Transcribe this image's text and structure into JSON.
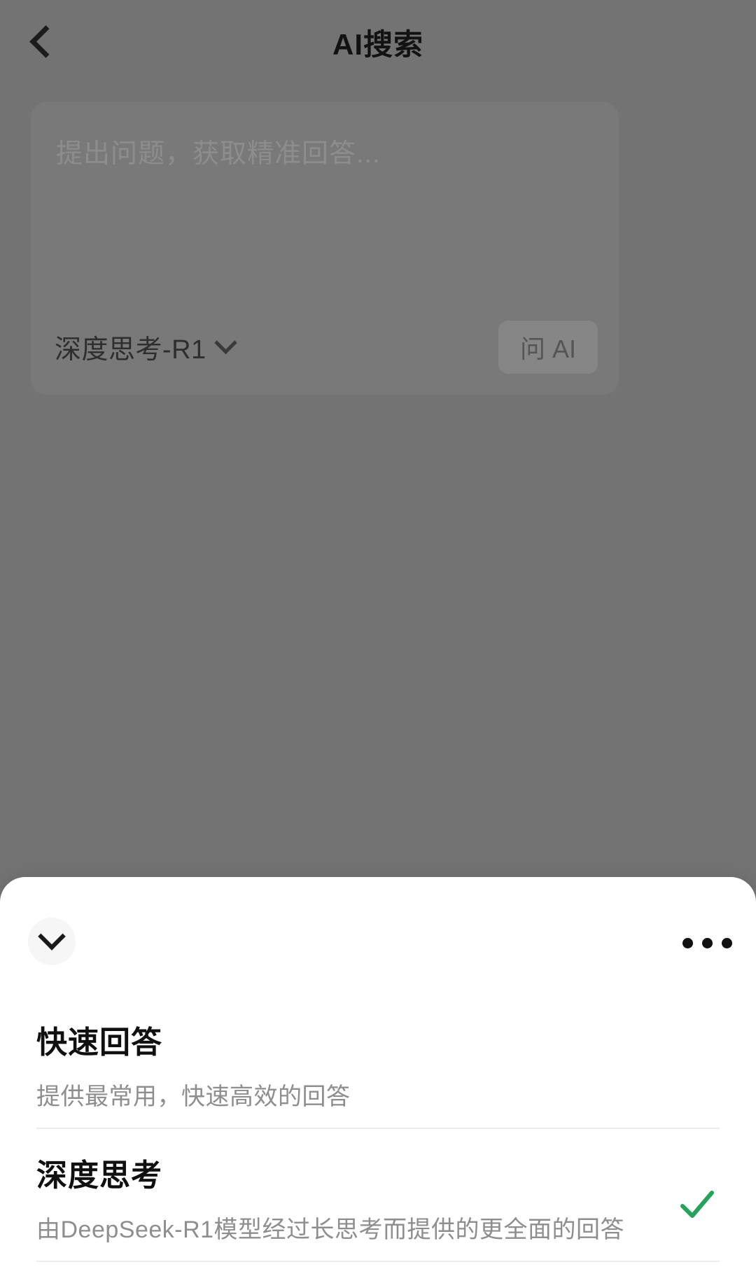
{
  "nav": {
    "back_icon": "chevron-left-icon",
    "title": "AI搜索"
  },
  "composer": {
    "placeholder": "提出问题，获取精准回答...",
    "model_label": "深度思考-R1",
    "model_chevron_icon": "chevron-down-icon",
    "ask_button_label": "问 AI"
  },
  "sheet": {
    "collapse_icon": "chevron-down-icon",
    "more_icon": "more-horizontal-icon",
    "options": [
      {
        "title": "快速回答",
        "desc": "提供最常用，快速高效的回答",
        "selected": false
      },
      {
        "title": "深度思考",
        "desc": "由DeepSeek-R1模型经过长思考而提供的更全面的回答",
        "selected": true,
        "check_icon": "check-icon"
      }
    ]
  },
  "colors": {
    "scrim": "#737373",
    "sheet_bg": "#ffffff",
    "accent_check": "#26a35a",
    "title_text": "#101010",
    "desc_text": "#8e8e8e",
    "divider": "#ededed"
  }
}
